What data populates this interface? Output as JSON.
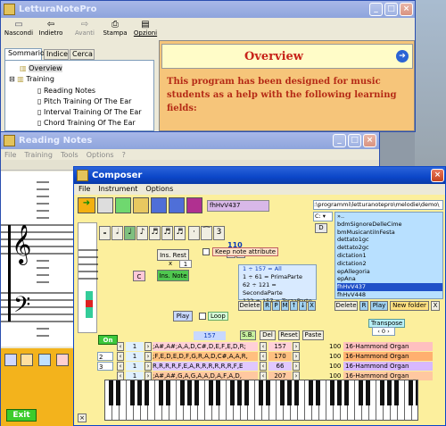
{
  "lettura": {
    "title": "LetturaNotePro",
    "toolbar": [
      "Nascondi",
      "Indietro",
      "Avanti",
      "Stampa",
      "Opzioni"
    ],
    "tabs": [
      "Sommario",
      "Indice",
      "Cerca"
    ],
    "tree": [
      "Overview",
      "Training",
      "Reading Notes",
      "Pitch Training Of The Ear",
      "Interval Training Of The Ear",
      "Chord Training Of The Ear"
    ],
    "heading": "Overview",
    "text": "This program has been designed for music students as a help with the following learning fields:"
  },
  "reading": {
    "title": "Reading Notes",
    "menu": [
      "File",
      "Training",
      "Tools",
      "Options",
      "?"
    ],
    "exit": "Exit"
  },
  "composer": {
    "title": "Composer",
    "menu": [
      "File",
      "Instrument",
      "Options"
    ],
    "filename": "fhHvV437",
    "path": ":\\programmi\\letturanotepro\\melodie\\demo\\",
    "drive": "C:",
    "d_button": "D",
    "value_110": "110",
    "ins_rest": "Ins. Rest",
    "x_label": "x",
    "x_val": "1",
    "ins_note": "Ins. Note",
    "c_button": "C",
    "keep_attr": "Keep note attribute",
    "files": [
      "»..",
      "bdmSignoreDelleCime",
      "bmMusicantiInFesta",
      "dettato1gc",
      "dettato2gc",
      "dictation1",
      "dictation2",
      "epAllegoria",
      "epAna",
      "fhHvV437",
      "fhHvV448"
    ],
    "parts": [
      "1 ÷ 157 = All",
      "1 ÷ 61 = PrimaParte",
      "62 ÷ 121 = SecondaParte",
      "122 ÷ 157 = TerzaParte"
    ],
    "part_buttons": [
      "Delete",
      "R",
      "P",
      "M",
      "↑",
      "↓",
      "X"
    ],
    "file_buttons": [
      "Delete",
      "R",
      "Play",
      "New folder",
      "X"
    ],
    "play": "Play",
    "loop": "Loop",
    "transpose_label": "Transpose",
    "transpose_val": "0",
    "counter": "157",
    "sb": "S.B.",
    "del": "Del",
    "reset": "Reset",
    "paste": "Paste",
    "on": "On",
    "tracks": [
      {
        "num": "",
        "n": "1",
        "notes": ";A#,A#;A,A,D,C#,D,E,F,E,D,R;",
        "count": "157",
        "vol": "100",
        "instr": "16-Hammond Organ",
        "color": "#ffc0c0"
      },
      {
        "num": "2",
        "n": "1",
        "notes": ";F,E,D,E,D,F,G,R,A,D,C#,A,A,R,",
        "count": "170",
        "vol": "100",
        "instr": "16-Hammond Organ",
        "color": "#ffb070"
      },
      {
        "num": "3",
        "n": "1",
        "notes": "R,R,R,R,F,E,A,R,R,R,R,R,R,F,E",
        "count": "66",
        "vol": "100",
        "instr": "16-Hammond Organ",
        "color": "#d8b8ff"
      },
      {
        "num": "",
        "n": "1",
        "notes": ";A#,A#,G,A,G,A,A,D,A,F,A,D,",
        "count": "207",
        "vol": "100",
        "instr": "16-Hammond Organ",
        "color": "#ffc8a0"
      }
    ]
  }
}
